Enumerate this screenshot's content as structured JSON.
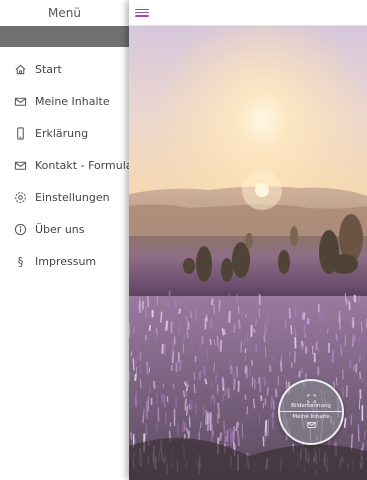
{
  "sidebar": {
    "title": "Menü",
    "items": [
      {
        "label": "Start",
        "icon": "home-icon"
      },
      {
        "label": "Meine Inhalte",
        "icon": "envelope-open-icon"
      },
      {
        "label": "Erklärung",
        "icon": "phone-icon"
      },
      {
        "label": "Kontakt - Formular",
        "icon": "envelope-icon"
      },
      {
        "label": "Einstellungen",
        "icon": "gear-icon"
      },
      {
        "label": "Über uns",
        "icon": "info-icon"
      },
      {
        "label": "Impressum",
        "icon": "paragraph-icon"
      }
    ]
  },
  "topbar": {
    "menu_icon": "hamburger-icon"
  },
  "hero": {
    "description_icon": "landscape-image"
  },
  "fab": {
    "top_label": "Bilderkennung",
    "top_icon": "scan-frame-icon",
    "bottom_label": "Meine Inhalte",
    "bottom_icon": "envelope-open-icon"
  },
  "colors": {
    "accent": "#9c4fa5",
    "sidebar_bar": "#707070",
    "text": "#444444"
  }
}
